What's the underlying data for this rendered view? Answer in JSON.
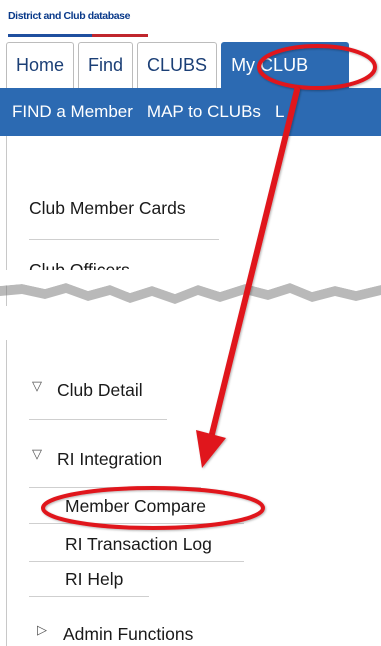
{
  "header": {
    "brand": "District and Club database"
  },
  "tabs": [
    {
      "label": "Home"
    },
    {
      "label": "Find"
    },
    {
      "label": "CLUBS"
    },
    {
      "label": "My CLUB",
      "active": true
    }
  ],
  "subnav": [
    {
      "label": "FIND a Member"
    },
    {
      "label": "MAP to CLUBs"
    },
    {
      "label": "L"
    }
  ],
  "sidebar_top": [
    {
      "label": "Club Member Cards"
    },
    {
      "label": "Club Officers"
    }
  ],
  "tree": {
    "club_detail": "Club Detail",
    "ri_integration": "RI Integration",
    "children": [
      {
        "label": "Member Compare"
      },
      {
        "label": "RI Transaction Log"
      },
      {
        "label": "RI Help"
      }
    ],
    "admin": "Admin Functions"
  },
  "colors": {
    "accent_blue": "#2c6ab2",
    "annotation_red": "#e0161c"
  },
  "icons": {
    "collapsed": "triangle-right-icon",
    "expanded": "triangle-down-icon"
  }
}
